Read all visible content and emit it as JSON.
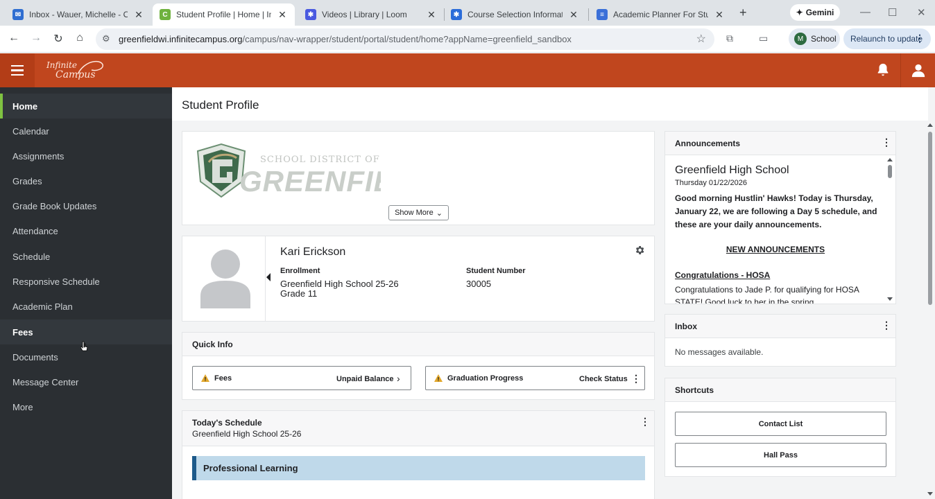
{
  "browser": {
    "tabs": [
      {
        "title": "Inbox - Wauer, Michelle - Outlo",
        "favicon_color": "#2f6ed1"
      },
      {
        "title": "Student Profile | Home | Infinite",
        "favicon_color": "#6fb23e"
      },
      {
        "title": "Videos | Library | Loom",
        "favicon_color": "#4a5ae0"
      },
      {
        "title": "Course Selection Information a",
        "favicon_color": "#2b6cd9"
      },
      {
        "title": "Academic Planner For Students",
        "favicon_color": "#3a6fd8"
      }
    ],
    "gemini_label": "Gemini",
    "url_host": "greenfieldwi.infinitecampus.org",
    "url_path": "/campus/nav-wrapper/student/portal/student/home?appName=greenfield_sandbox",
    "profile_initial": "M",
    "profile_label": "School",
    "relaunch_label": "Relaunch to update"
  },
  "app": {
    "logo_line1": "Infinite",
    "logo_line2": "Campus",
    "header_color": "#c0461e"
  },
  "sidebar": {
    "items": [
      {
        "label": "Home"
      },
      {
        "label": "Calendar"
      },
      {
        "label": "Assignments"
      },
      {
        "label": "Grades"
      },
      {
        "label": "Grade Book Updates"
      },
      {
        "label": "Attendance"
      },
      {
        "label": "Schedule"
      },
      {
        "label": "Responsive Schedule"
      },
      {
        "label": "Academic Plan"
      },
      {
        "label": "Fees"
      },
      {
        "label": "Documents"
      },
      {
        "label": "Message Center"
      },
      {
        "label": "More"
      }
    ]
  },
  "main": {
    "page_title": "Student Profile",
    "district_logo_line1": "SCHOOL DISTRICT OF",
    "district_logo_line2": "GREENFIELD",
    "show_more_label": "Show More",
    "student": {
      "name": "Kari Erickson",
      "enrollment_label": "Enrollment",
      "enrollment_school": "Greenfield High School 25-26",
      "enrollment_grade": "Grade 11",
      "number_label": "Student Number",
      "number_value": "30005"
    },
    "quick_info": {
      "title": "Quick Info",
      "fees_label": "Fees",
      "fees_status": "Unpaid Balance",
      "grad_label": "Graduation Progress",
      "grad_status": "Check Status"
    },
    "schedule": {
      "title": "Today's Schedule",
      "subtitle": "Greenfield High School 25-26",
      "block": "Professional Learning"
    }
  },
  "right": {
    "announcements": {
      "title": "Announcements",
      "school": "Greenfield High School",
      "date": "Thursday 01/22/2026",
      "text": "Good morning Hustlin' Hawks!  Today is Thursday, January 22, we are following a Day 5 schedule, and these are your daily announcements.",
      "new_heading": "NEW ANNOUNCEMENTS",
      "congrats_heading": "Congratulations - HOSA",
      "congrats_text": "Congratulations to Jade P. for qualifying for HOSA STATE! Good luck to her in the spring"
    },
    "inbox": {
      "title": "Inbox",
      "empty_message": "No messages available."
    },
    "shortcuts": {
      "title": "Shortcuts",
      "items": [
        {
          "label": "Contact List"
        },
        {
          "label": "Hall Pass"
        }
      ]
    }
  }
}
